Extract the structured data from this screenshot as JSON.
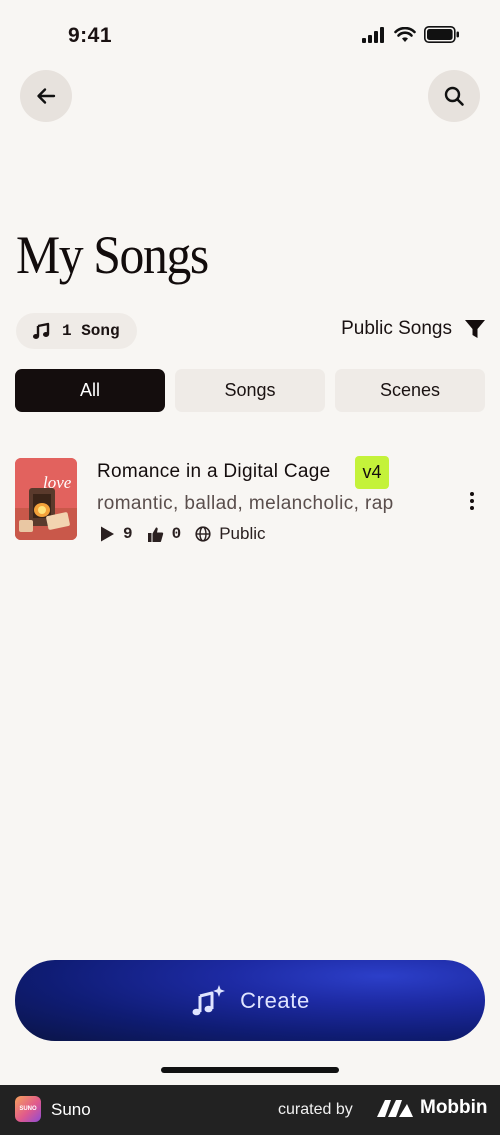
{
  "status_bar": {
    "time": "9:41"
  },
  "page": {
    "title": "My Songs"
  },
  "song_count": {
    "label": "1 Song"
  },
  "filter": {
    "label": "Public Songs"
  },
  "tabs": [
    {
      "label": "All",
      "active": true
    },
    {
      "label": "Songs",
      "active": false
    },
    {
      "label": "Scenes",
      "active": false
    }
  ],
  "songs": [
    {
      "title": "Romance in a Digital Cage",
      "version": "v4",
      "tags": "romantic, ballad, melancholic, rap",
      "plays": "9",
      "likes": "0",
      "visibility": "Public",
      "cover_text": "love"
    }
  ],
  "create": {
    "label": "Create"
  },
  "footer": {
    "app_icon_text": "SUNO",
    "app_name": "Suno",
    "curated_by": "curated by",
    "brand": "Mobbin"
  },
  "colors": {
    "background": "#f8f6f3",
    "active_tab": "#140d0d",
    "version_badge": "#c4f23a",
    "create_button": "#1d2aa3"
  }
}
